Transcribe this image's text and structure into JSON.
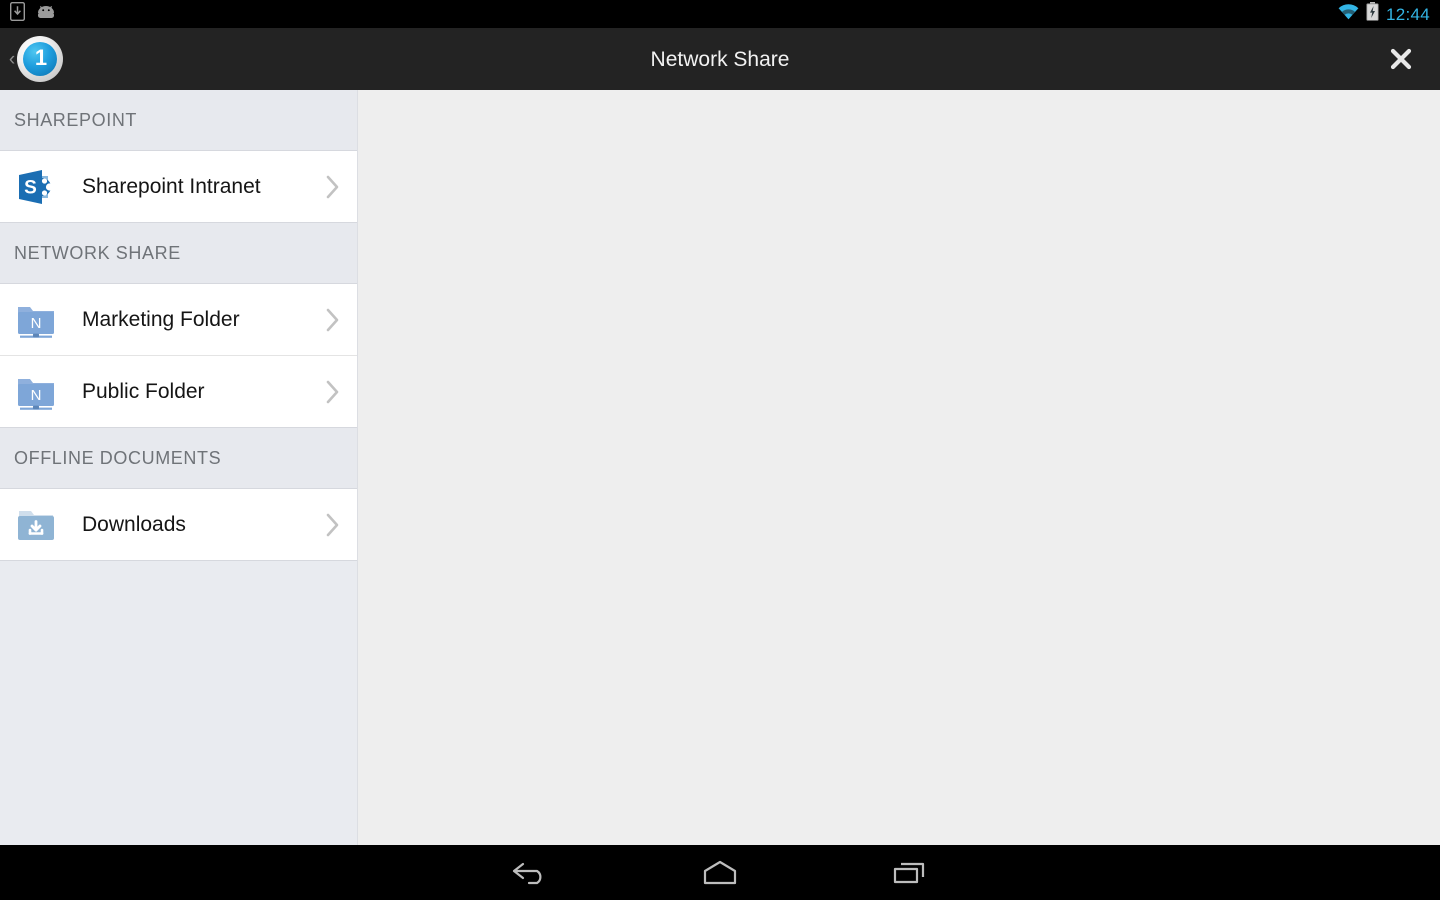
{
  "status_bar": {
    "notification_icons": [
      "download-notification-icon",
      "android-bugdroid-icon"
    ],
    "wifi_icon": "wifi-icon",
    "battery_icon": "battery-charging-icon",
    "time": "12:44",
    "time_color": "#33b5e5"
  },
  "title_bar": {
    "back_chevron": "‹",
    "logo_icon": "app-logo-icon",
    "logo_glyph": "1",
    "title": "Network Share",
    "close_icon": "close-icon",
    "background_color": "#232323"
  },
  "sidebar": {
    "sections": [
      {
        "header": "SHAREPOINT",
        "items": [
          {
            "label": "Sharepoint Intranet",
            "icon": "sharepoint-icon",
            "chevron": "chevron-right-icon"
          }
        ]
      },
      {
        "header": "NETWORK SHARE",
        "items": [
          {
            "label": "Marketing Folder",
            "icon": "network-folder-icon",
            "chevron": "chevron-right-icon"
          },
          {
            "label": "Public Folder",
            "icon": "network-folder-icon",
            "chevron": "chevron-right-icon"
          }
        ]
      },
      {
        "header": "OFFLINE DOCUMENTS",
        "items": [
          {
            "label": "Downloads",
            "icon": "downloads-folder-icon",
            "chevron": "chevron-right-icon"
          }
        ]
      }
    ]
  },
  "content_panel": {
    "background_color": "#eeeeee",
    "empty": true
  },
  "nav_bar": {
    "buttons": [
      {
        "name": "back",
        "icon": "nav-back-icon"
      },
      {
        "name": "home",
        "icon": "nav-home-icon"
      },
      {
        "name": "recents",
        "icon": "nav-recents-icon"
      }
    ],
    "background_color": "#000000"
  },
  "colors": {
    "accent": "#33b5e5",
    "sharepoint_blue": "#1b6eb3",
    "network_folder_blue": "#7ea6d8",
    "downloads_folder_blue": "#8fb4d4"
  }
}
